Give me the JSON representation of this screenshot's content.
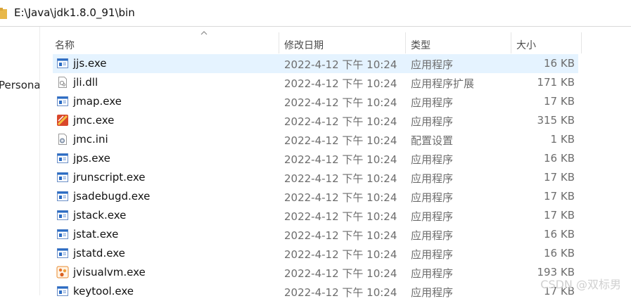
{
  "address": {
    "path": "E:\\Java\\jdk1.8.0_91\\bin"
  },
  "nav": {
    "label": "Persona"
  },
  "columns": {
    "name": "名称",
    "date": "修改日期",
    "type": "类型",
    "size": "大小"
  },
  "colors": {
    "selected_row": "#e5f3ff",
    "folder": "#e8b84a",
    "exe_icon_blue": "#2b6cc4"
  },
  "files": [
    {
      "name": "jjs.exe",
      "date": "2022-4-12 下午 10:24",
      "type": "应用程序",
      "size": "16 KB",
      "icon": "exe-icon",
      "selected": true
    },
    {
      "name": "jli.dll",
      "date": "2022-4-12 下午 10:24",
      "type": "应用程序扩展",
      "size": "171 KB",
      "icon": "dll-icon"
    },
    {
      "name": "jmap.exe",
      "date": "2022-4-12 下午 10:24",
      "type": "应用程序",
      "size": "17 KB",
      "icon": "exe-icon"
    },
    {
      "name": "jmc.exe",
      "date": "2022-4-12 下午 10:24",
      "type": "应用程序",
      "size": "315 KB",
      "icon": "jmc-icon"
    },
    {
      "name": "jmc.ini",
      "date": "2022-4-12 下午 10:24",
      "type": "配置设置",
      "size": "1 KB",
      "icon": "ini-icon"
    },
    {
      "name": "jps.exe",
      "date": "2022-4-12 下午 10:24",
      "type": "应用程序",
      "size": "16 KB",
      "icon": "exe-icon"
    },
    {
      "name": "jrunscript.exe",
      "date": "2022-4-12 下午 10:24",
      "type": "应用程序",
      "size": "17 KB",
      "icon": "exe-icon"
    },
    {
      "name": "jsadebugd.exe",
      "date": "2022-4-12 下午 10:24",
      "type": "应用程序",
      "size": "17 KB",
      "icon": "exe-icon"
    },
    {
      "name": "jstack.exe",
      "date": "2022-4-12 下午 10:24",
      "type": "应用程序",
      "size": "17 KB",
      "icon": "exe-icon"
    },
    {
      "name": "jstat.exe",
      "date": "2022-4-12 下午 10:24",
      "type": "应用程序",
      "size": "16 KB",
      "icon": "exe-icon"
    },
    {
      "name": "jstatd.exe",
      "date": "2022-4-12 下午 10:24",
      "type": "应用程序",
      "size": "16 KB",
      "icon": "exe-icon"
    },
    {
      "name": "jvisualvm.exe",
      "date": "2022-4-12 下午 10:24",
      "type": "应用程序",
      "size": "193 KB",
      "icon": "jvisualvm-icon"
    },
    {
      "name": "keytool.exe",
      "date": "2022-4-12 下午 10:24",
      "type": "应用程序",
      "size": "17 KB",
      "icon": "exe-icon"
    }
  ],
  "watermark": "CSDN @双标男"
}
